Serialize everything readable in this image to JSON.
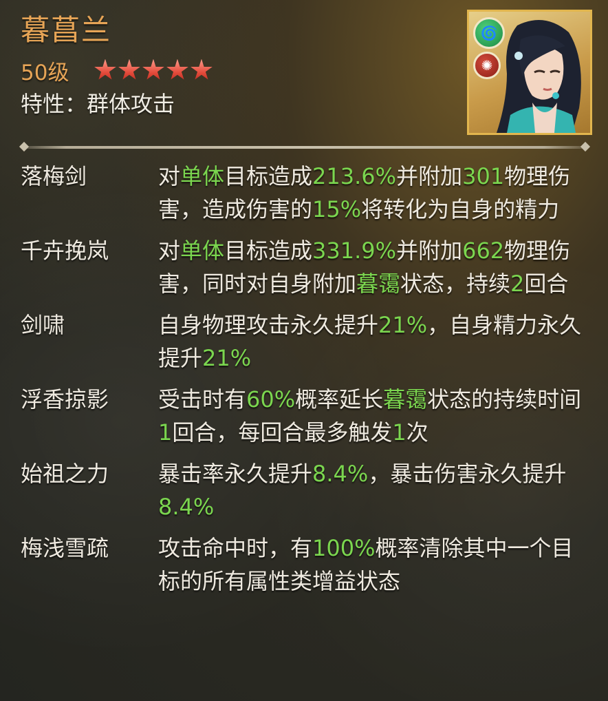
{
  "hero": {
    "name": "暮菖兰",
    "level": "50级",
    "stars": 5,
    "trait_label": "特性：",
    "trait_value": "群体攻击",
    "portrait_badges": [
      "wind-element-icon",
      "scorpion-icon"
    ]
  },
  "skills": [
    {
      "name": "落梅剑",
      "desc": [
        {
          "t": "对",
          "h": false
        },
        {
          "t": "单体",
          "h": true
        },
        {
          "t": "目标造成",
          "h": false
        },
        {
          "t": "213.6%",
          "h": true
        },
        {
          "t": "并附加",
          "h": false
        },
        {
          "t": "301",
          "h": true
        },
        {
          "t": "物理伤害，造成伤害的",
          "h": false
        },
        {
          "t": "15%",
          "h": true
        },
        {
          "t": "将转化为自身的精力",
          "h": false
        }
      ]
    },
    {
      "name": "千卉挽岚",
      "desc": [
        {
          "t": "对",
          "h": false
        },
        {
          "t": "单体",
          "h": true
        },
        {
          "t": "目标造成",
          "h": false
        },
        {
          "t": "331.9%",
          "h": true
        },
        {
          "t": "并附加",
          "h": false
        },
        {
          "t": "662",
          "h": true
        },
        {
          "t": "物理伤害，同时对自身附加",
          "h": false
        },
        {
          "t": "暮霭",
          "h": true
        },
        {
          "t": "状态，持续",
          "h": false
        },
        {
          "t": "2",
          "h": true
        },
        {
          "t": "回合",
          "h": false
        }
      ]
    },
    {
      "name": "剑啸",
      "desc": [
        {
          "t": "自身物理攻击永久提升",
          "h": false
        },
        {
          "t": "21%",
          "h": true
        },
        {
          "t": "，自身精力永久提升",
          "h": false
        },
        {
          "t": "21%",
          "h": true
        }
      ]
    },
    {
      "name": "浮香掠影",
      "desc": [
        {
          "t": "受击时有",
          "h": false
        },
        {
          "t": "60%",
          "h": true
        },
        {
          "t": "概率延长",
          "h": false
        },
        {
          "t": "暮霭",
          "h": true
        },
        {
          "t": "状态的持续时间",
          "h": false
        },
        {
          "t": "1",
          "h": true
        },
        {
          "t": "回合，每回合最多触发",
          "h": false
        },
        {
          "t": "1",
          "h": true
        },
        {
          "t": "次",
          "h": false
        }
      ]
    },
    {
      "name": "始祖之力",
      "desc": [
        {
          "t": "暴击率永久提升",
          "h": false
        },
        {
          "t": "8.4%",
          "h": true
        },
        {
          "t": "，暴击伤害永久提升",
          "h": false
        },
        {
          "t": "8.4%",
          "h": true
        }
      ]
    },
    {
      "name": "梅浅雪疏",
      "desc": [
        {
          "t": "攻击命中时，有",
          "h": false
        },
        {
          "t": "100%",
          "h": true
        },
        {
          "t": "概率清除其中一个目标的所有属性类增益状态",
          "h": false
        }
      ]
    }
  ],
  "colors": {
    "name": "#e6a456",
    "highlight": "#7bd64f",
    "text": "#efeae0"
  }
}
